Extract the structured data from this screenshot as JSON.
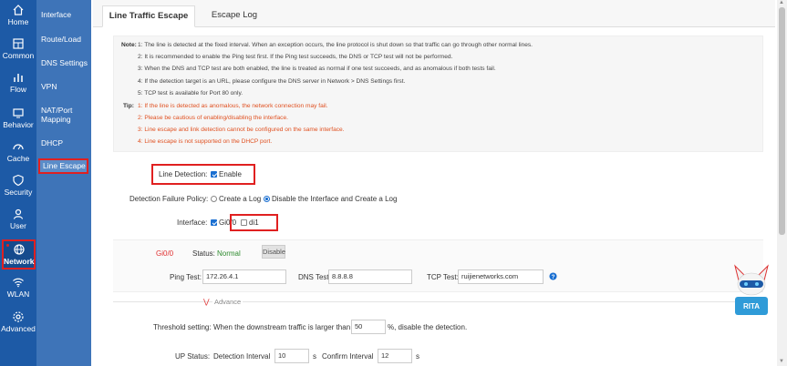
{
  "rail": [
    {
      "name": "home",
      "icon": "home-icon",
      "label": "Home"
    },
    {
      "name": "common",
      "icon": "grid-icon",
      "label": "Common"
    },
    {
      "name": "flow",
      "icon": "chart-icon",
      "label": "Flow"
    },
    {
      "name": "behavior",
      "icon": "behavior-icon",
      "label": "Behavior"
    },
    {
      "name": "cache",
      "icon": "gauge-icon",
      "label": "Cache"
    },
    {
      "name": "security",
      "icon": "shield-icon",
      "label": "Security"
    },
    {
      "name": "user",
      "icon": "user-icon",
      "label": "User"
    },
    {
      "name": "network",
      "icon": "globe-icon",
      "label": "Network"
    },
    {
      "name": "wlan",
      "icon": "wifi-icon",
      "label": "WLAN"
    },
    {
      "name": "advanced",
      "icon": "gear-icon",
      "label": "Advanced"
    }
  ],
  "submenu": [
    {
      "label": "Interface"
    },
    {
      "label": "Route/Load"
    },
    {
      "label": "DNS Settings"
    },
    {
      "label": "VPN"
    },
    {
      "label": "NAT/Port"
    },
    {
      "label": "Mapping"
    },
    {
      "label": "DHCP"
    },
    {
      "label": "Line Escape"
    }
  ],
  "tabs": {
    "line_traffic": "Line Traffic Escape",
    "escape_log": "Escape Log"
  },
  "note": {
    "note_key": "Note:",
    "tip_key": "Tip:",
    "notes": [
      "1: The line is detected at the fixed interval. When an exception occurs, the line protocol is shut down so that traffic can go through other normal lines.",
      "2: It is recommended to enable the Ping test first. If the Ping test succeeds, the DNS or TCP test will not be performed.",
      "3: When the DNS and TCP test are both enabled, the line is treated as normal if one test succeeds, and as anomalous if both tests fail.",
      "4: If the detection target is an URL, please configure the DNS server in Network > DNS Settings first.",
      "5: TCP test is available for Port 80 only."
    ],
    "tips": [
      "1: If the line is detected as anomalous, the network connection may fail.",
      "2: Please be cautious of enabling/disabling the interface.",
      "3: Line escape and link detection cannot be configured on the same interface.",
      "4: Line escape is not supported on the DHCP port."
    ]
  },
  "form": {
    "line_detection_label": "Line Detection:",
    "enable_label": "Enable",
    "policy_label": "Detection Failure Policy:",
    "policy_opt1": "Create a Log",
    "policy_opt2": "Disable the Interface and Create a Log",
    "interface_label": "Interface:",
    "iface1": "Gi0/0",
    "iface2": "di1"
  },
  "gi": {
    "name": "Gi0/0",
    "status_label": "Status:",
    "status_value": "Normal",
    "disable_btn": "Disable",
    "ping_label": "Ping Test:",
    "ping_value": "172.26.4.1",
    "dns_label": "DNS Test:",
    "dns_value": "8.8.8.8",
    "tcp_label": "TCP Test:",
    "tcp_value": "ruijienetworks.com"
  },
  "advance": {
    "label": "Advance",
    "threshold_label": "Threshold setting:",
    "threshold_text1": "When the downstream traffic is larger than",
    "threshold_value": "50",
    "threshold_text2": "%, disable the detection.",
    "up_label": "UP Status:",
    "det_interval_label": "Detection Interval",
    "det_interval_value": "10",
    "s1": "s",
    "confirm_label": "Confirm Interval",
    "confirm_value": "12",
    "s2": "s"
  },
  "mascot": {
    "text": "RITA"
  },
  "colors": {
    "rail": "#1d5aa6",
    "submenu": "#3e74b8",
    "highlight": "#e02020",
    "status_ok": "#2e8b2e",
    "tip": "#e05020"
  }
}
